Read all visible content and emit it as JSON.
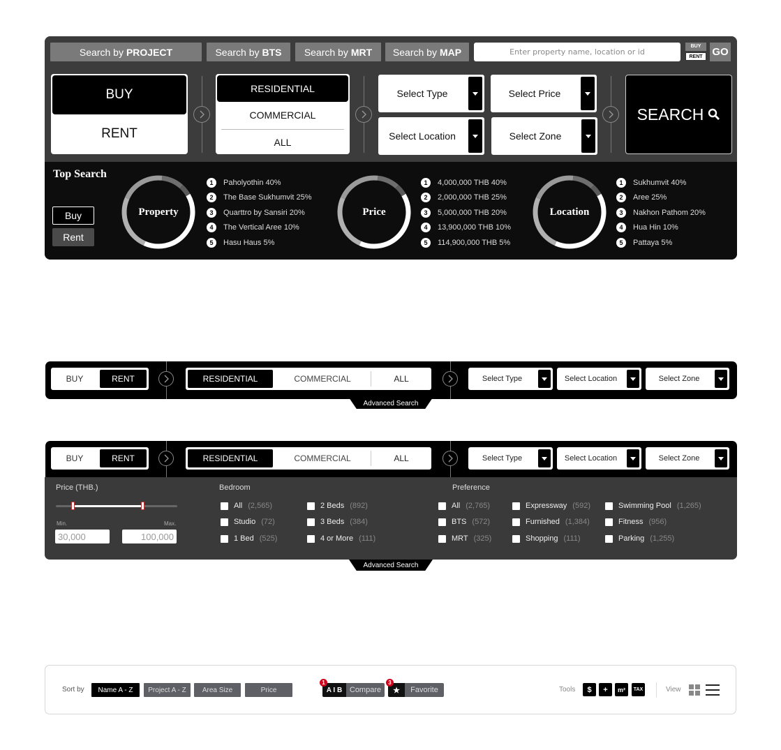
{
  "main_search": {
    "tabs": [
      {
        "prefix": "Search by",
        "bold": "PROJECT"
      },
      {
        "prefix": "Search by",
        "bold": "BTS"
      },
      {
        "prefix": "Search by",
        "bold": "MRT"
      },
      {
        "prefix": "Search by",
        "bold": "MAP"
      }
    ],
    "search_placeholder": "Enter property name, location or id",
    "mini_toggle": {
      "buy": "BUY",
      "rent": "RENT"
    },
    "go_label": "GO",
    "deal_type": {
      "options": [
        "BUY",
        "RENT"
      ],
      "selected": "BUY"
    },
    "category": {
      "options": [
        "RESIDENTIAL",
        "COMMERCIAL",
        "ALL"
      ],
      "selected": "RESIDENTIAL"
    },
    "dropdowns": {
      "type": "Select Type",
      "price": "Select Price",
      "location": "Select Location",
      "zone": "Select Zone"
    },
    "search_button": "SEARCH",
    "top_search": {
      "title": "Top Search",
      "buy": "Buy",
      "rent": "Rent",
      "groups": [
        {
          "label": "Property",
          "items": [
            {
              "rank": "1",
              "text": "Paholyothin 40%"
            },
            {
              "rank": "2",
              "text": "The Base Sukhumvit  25%"
            },
            {
              "rank": "3",
              "text": "Quarttro by Sansiri  20%"
            },
            {
              "rank": "4",
              "text": "The Vertical Aree  10%"
            },
            {
              "rank": "5",
              "text": "Hasu Haus  5%"
            }
          ]
        },
        {
          "label": "Price",
          "items": [
            {
              "rank": "1",
              "text": "4,000,000 THB  40%"
            },
            {
              "rank": "2",
              "text": "2,000,000 THB  25%"
            },
            {
              "rank": "3",
              "text": "5,000,000 THB  20%"
            },
            {
              "rank": "4",
              "text": "13,900,000 THB  10%"
            },
            {
              "rank": "5",
              "text": "114,900,000 THB  5%"
            }
          ]
        },
        {
          "label": "Location",
          "items": [
            {
              "rank": "1",
              "text": "Sukhumvit 40%"
            },
            {
              "rank": "2",
              "text": "Aree 25%"
            },
            {
              "rank": "3",
              "text": "Nakhon Pathom  20%"
            },
            {
              "rank": "4",
              "text": "Hua Hin  10%"
            },
            {
              "rank": "5",
              "text": "Pattaya  5%"
            }
          ]
        }
      ],
      "ring_shares": [
        40,
        25,
        20,
        10,
        5
      ],
      "ring_colors": [
        "#ffffff",
        "#b0b0b0",
        "#9a9a9a",
        "#6e6e6e",
        "#5a5a5a"
      ]
    }
  },
  "compact_bar": {
    "buy": "BUY",
    "rent": "RENT",
    "selected_deal": "RENT",
    "residential": "RESIDENTIAL",
    "commercial": "COMMERCIAL",
    "all": "ALL",
    "select_type": "Select Type",
    "select_location": "Select Location",
    "select_zone": "Select Zone",
    "advanced_search": "Advanced Search"
  },
  "advanced": {
    "price": {
      "heading": "Price (THB.)",
      "min_label": "Min.",
      "max_label": "Max.",
      "min_value": "30,000",
      "max_value": "100,000",
      "range_fraction": [
        0.14,
        0.71
      ]
    },
    "bedroom": {
      "heading": "Bedroom",
      "options": [
        {
          "label": "All",
          "count": "(2,565)"
        },
        {
          "label": "Studio",
          "count": "(72)"
        },
        {
          "label": "1 Bed",
          "count": "(525)"
        },
        {
          "label": "2 Beds",
          "count": "(892)"
        },
        {
          "label": "3 Beds",
          "count": "(384)"
        },
        {
          "label": "4 or More",
          "count": "(111)"
        }
      ]
    },
    "preference": {
      "heading": "Preference",
      "options": [
        {
          "label": "All",
          "count": "(2,765)"
        },
        {
          "label": "BTS",
          "count": "(572)"
        },
        {
          "label": "MRT",
          "count": "(325)"
        },
        {
          "label": "Expressway",
          "count": "(592)"
        },
        {
          "label": "Furnished",
          "count": "(1,384)"
        },
        {
          "label": "Shopping",
          "count": "(111)"
        },
        {
          "label": "Swimming Pool",
          "count": "(1,265)"
        },
        {
          "label": "Fitness",
          "count": "(956)"
        },
        {
          "label": "Parking",
          "count": "(1,255)"
        }
      ]
    }
  },
  "toolbar": {
    "sort_label": "Sort by",
    "sort_options": [
      "Name A - Z",
      "Project A - Z",
      "Area Size",
      "Price"
    ],
    "sort_selected": "Name A - Z",
    "compare": {
      "icon_text": "A I B",
      "label": "Compare",
      "badge": "1"
    },
    "favorite": {
      "icon_text": "★",
      "label": "Favorite",
      "badge": "3"
    },
    "tools_label": "Tools",
    "tools": [
      {
        "name": "currency-tool",
        "text": "$"
      },
      {
        "name": "add-tool",
        "text": "+"
      },
      {
        "name": "area-tool",
        "text": "m²"
      },
      {
        "name": "tax-tool",
        "text": "TAX"
      }
    ],
    "view_label": "View"
  }
}
